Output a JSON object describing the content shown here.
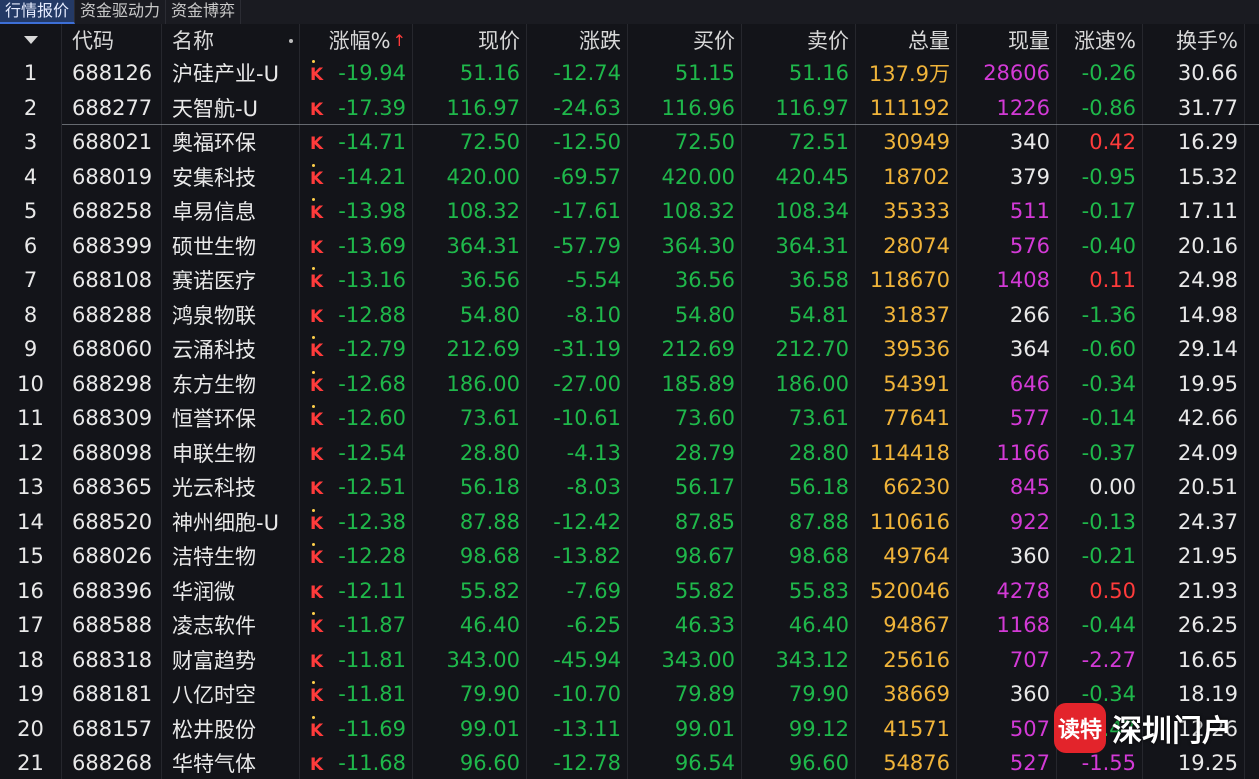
{
  "tabs": [
    "行情报价",
    "资金驱动力",
    "资金博弈"
  ],
  "header": {
    "code": "代码",
    "name": "名称",
    "pct": "涨幅%",
    "pct_arrow": "↑",
    "price": "现价",
    "change": "涨跌",
    "bid": "买价",
    "ask": "卖价",
    "volume": "总量",
    "current_vol": "现量",
    "speed": "涨速%",
    "turnover": "换手%"
  },
  "watermark": {
    "badge": "读特",
    "text": "深圳门户"
  },
  "colors": {
    "background": "#131419",
    "green": "#1fb84b",
    "red": "#ff3b3b",
    "yellow": "#f0b43a",
    "magenta": "#d33ad6",
    "active_tab": "#243a66"
  },
  "rows": [
    {
      "num": "1",
      "code": "688126",
      "name": "沪硅产业-U",
      "pct": "-19.94",
      "price": "51.16",
      "chg": "-12.74",
      "bid": "51.15",
      "ask": "51.16",
      "vol": "137.9万",
      "cur": "28606",
      "curColor": "magenta",
      "spd": "-0.26",
      "spdColor": "green",
      "turn": "30.66",
      "kdot": true
    },
    {
      "num": "2",
      "code": "688277",
      "name": "天智航-U",
      "pct": "-17.39",
      "price": "116.97",
      "chg": "-24.63",
      "bid": "116.96",
      "ask": "116.97",
      "vol": "111192",
      "cur": "1226",
      "curColor": "magenta",
      "spd": "-0.86",
      "spdColor": "green",
      "turn": "31.77",
      "kdot": false
    },
    {
      "num": "3",
      "code": "688021",
      "name": "奥福环保",
      "pct": "-14.71",
      "price": "72.50",
      "chg": "-12.50",
      "bid": "72.50",
      "ask": "72.51",
      "vol": "30949",
      "cur": "340",
      "curColor": "white",
      "spd": "0.42",
      "spdColor": "red",
      "turn": "16.29",
      "kdot": false
    },
    {
      "num": "4",
      "code": "688019",
      "name": "安集科技",
      "pct": "-14.21",
      "price": "420.00",
      "chg": "-69.57",
      "bid": "420.00",
      "ask": "420.45",
      "vol": "18702",
      "cur": "379",
      "curColor": "white",
      "spd": "-0.95",
      "spdColor": "green",
      "turn": "15.32",
      "kdot": true
    },
    {
      "num": "5",
      "code": "688258",
      "name": "卓易信息",
      "pct": "-13.98",
      "price": "108.32",
      "chg": "-17.61",
      "bid": "108.32",
      "ask": "108.34",
      "vol": "35333",
      "cur": "511",
      "curColor": "magenta",
      "spd": "-0.17",
      "spdColor": "green",
      "turn": "17.11",
      "kdot": true
    },
    {
      "num": "6",
      "code": "688399",
      "name": "硕世生物",
      "pct": "-13.69",
      "price": "364.31",
      "chg": "-57.79",
      "bid": "364.30",
      "ask": "364.31",
      "vol": "28074",
      "cur": "576",
      "curColor": "magenta",
      "spd": "-0.40",
      "spdColor": "green",
      "turn": "20.16",
      "kdot": false
    },
    {
      "num": "7",
      "code": "688108",
      "name": "赛诺医疗",
      "pct": "-13.16",
      "price": "36.56",
      "chg": "-5.54",
      "bid": "36.56",
      "ask": "36.58",
      "vol": "118670",
      "cur": "1408",
      "curColor": "magenta",
      "spd": "0.11",
      "spdColor": "red",
      "turn": "24.98",
      "kdot": true
    },
    {
      "num": "8",
      "code": "688288",
      "name": "鸿泉物联",
      "pct": "-12.88",
      "price": "54.80",
      "chg": "-8.10",
      "bid": "54.80",
      "ask": "54.81",
      "vol": "31837",
      "cur": "266",
      "curColor": "white",
      "spd": "-1.36",
      "spdColor": "green",
      "turn": "14.98",
      "kdot": false
    },
    {
      "num": "9",
      "code": "688060",
      "name": "云涌科技",
      "pct": "-12.79",
      "price": "212.69",
      "chg": "-31.19",
      "bid": "212.69",
      "ask": "212.70",
      "vol": "39536",
      "cur": "364",
      "curColor": "white",
      "spd": "-0.60",
      "spdColor": "green",
      "turn": "29.14",
      "kdot": true
    },
    {
      "num": "10",
      "code": "688298",
      "name": "东方生物",
      "pct": "-12.68",
      "price": "186.00",
      "chg": "-27.00",
      "bid": "185.89",
      "ask": "186.00",
      "vol": "54391",
      "cur": "646",
      "curColor": "magenta",
      "spd": "-0.34",
      "spdColor": "green",
      "turn": "19.95",
      "kdot": true
    },
    {
      "num": "11",
      "code": "688309",
      "name": "恒誉环保",
      "pct": "-12.60",
      "price": "73.61",
      "chg": "-10.61",
      "bid": "73.60",
      "ask": "73.61",
      "vol": "77641",
      "cur": "577",
      "curColor": "magenta",
      "spd": "-0.14",
      "spdColor": "green",
      "turn": "42.66",
      "kdot": true
    },
    {
      "num": "12",
      "code": "688098",
      "name": "申联生物",
      "pct": "-12.54",
      "price": "28.80",
      "chg": "-4.13",
      "bid": "28.79",
      "ask": "28.80",
      "vol": "114418",
      "cur": "1166",
      "curColor": "magenta",
      "spd": "-0.37",
      "spdColor": "green",
      "turn": "24.09",
      "kdot": false
    },
    {
      "num": "13",
      "code": "688365",
      "name": "光云科技",
      "pct": "-12.51",
      "price": "56.18",
      "chg": "-8.03",
      "bid": "56.17",
      "ask": "56.18",
      "vol": "66230",
      "cur": "845",
      "curColor": "magenta",
      "spd": "0.00",
      "spdColor": "white",
      "turn": "20.51",
      "kdot": false
    },
    {
      "num": "14",
      "code": "688520",
      "name": "神州细胞-U",
      "pct": "-12.38",
      "price": "87.88",
      "chg": "-12.42",
      "bid": "87.85",
      "ask": "87.88",
      "vol": "110616",
      "cur": "922",
      "curColor": "magenta",
      "spd": "-0.13",
      "spdColor": "green",
      "turn": "24.37",
      "kdot": true
    },
    {
      "num": "15",
      "code": "688026",
      "name": "洁特生物",
      "pct": "-12.28",
      "price": "98.68",
      "chg": "-13.82",
      "bid": "98.67",
      "ask": "98.68",
      "vol": "49764",
      "cur": "360",
      "curColor": "white",
      "spd": "-0.21",
      "spdColor": "green",
      "turn": "21.95",
      "kdot": true
    },
    {
      "num": "16",
      "code": "688396",
      "name": "华润微",
      "pct": "-12.11",
      "price": "55.82",
      "chg": "-7.69",
      "bid": "55.82",
      "ask": "55.83",
      "vol": "520046",
      "cur": "4278",
      "curColor": "magenta",
      "spd": "0.50",
      "spdColor": "red",
      "turn": "21.93",
      "kdot": false
    },
    {
      "num": "17",
      "code": "688588",
      "name": "凌志软件",
      "pct": "-11.87",
      "price": "46.40",
      "chg": "-6.25",
      "bid": "46.33",
      "ask": "46.40",
      "vol": "94867",
      "cur": "1168",
      "curColor": "magenta",
      "spd": "-0.44",
      "spdColor": "green",
      "turn": "26.25",
      "kdot": true
    },
    {
      "num": "18",
      "code": "688318",
      "name": "财富趋势",
      "pct": "-11.81",
      "price": "343.00",
      "chg": "-45.94",
      "bid": "343.00",
      "ask": "343.12",
      "vol": "25616",
      "cur": "707",
      "curColor": "magenta",
      "spd": "-2.27",
      "spdColor": "magenta",
      "turn": "16.65",
      "kdot": false
    },
    {
      "num": "19",
      "code": "688181",
      "name": "八亿时空",
      "pct": "-11.81",
      "price": "79.90",
      "chg": "-10.70",
      "bid": "79.89",
      "ask": "79.90",
      "vol": "38669",
      "cur": "360",
      "curColor": "white",
      "spd": "-0.34",
      "spdColor": "green",
      "turn": "18.19",
      "kdot": true
    },
    {
      "num": "20",
      "code": "688157",
      "name": "松井股份",
      "pct": "-11.69",
      "price": "99.01",
      "chg": "-13.11",
      "bid": "99.01",
      "ask": "99.12",
      "vol": "41571",
      "cur": "507",
      "curColor": "magenta",
      "spd": "-0.47",
      "spdColor": "green",
      "turn": "12.26",
      "kdot": true
    },
    {
      "num": "21",
      "code": "688268",
      "name": "华特气体",
      "pct": "-11.68",
      "price": "96.60",
      "chg": "-12.78",
      "bid": "96.54",
      "ask": "96.60",
      "vol": "54876",
      "cur": "527",
      "curColor": "magenta",
      "spd": "-1.55",
      "spdColor": "magenta",
      "turn": "19.25",
      "kdot": false
    }
  ]
}
